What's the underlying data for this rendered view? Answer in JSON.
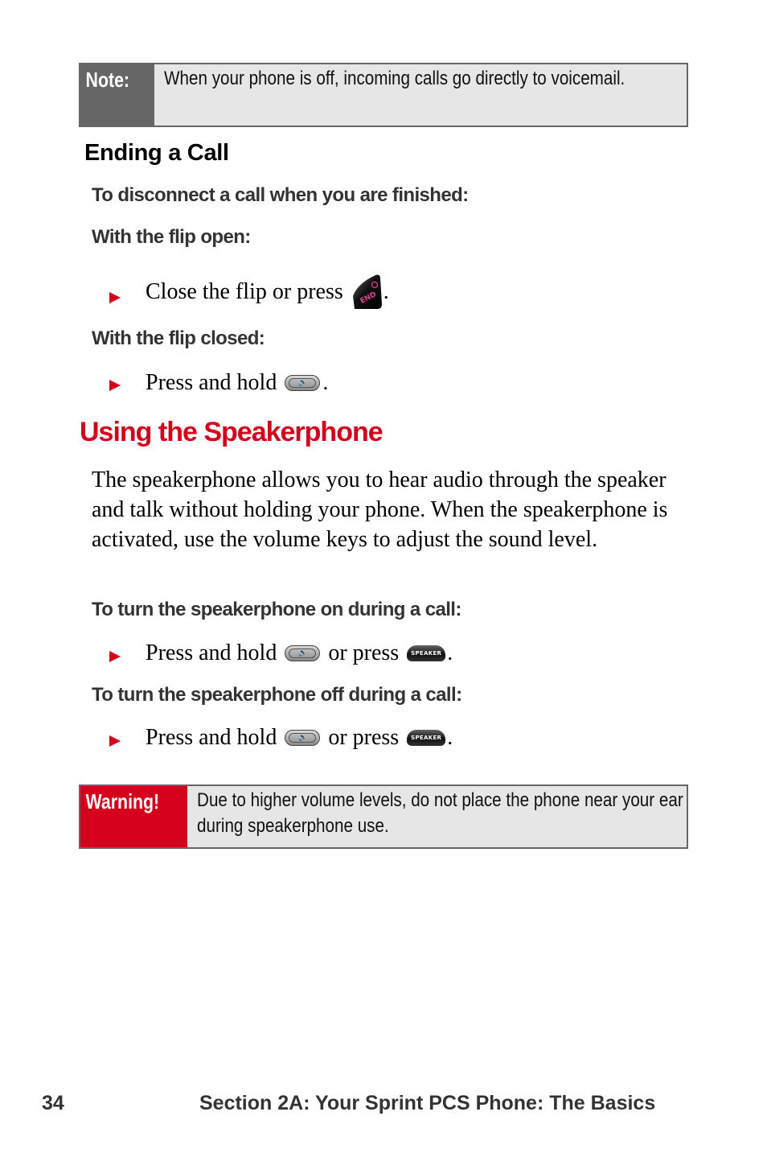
{
  "note": {
    "label": "Note:",
    "text": "When your phone is off, incoming calls go directly to voicemail."
  },
  "ending_call": {
    "heading": "Ending a Call",
    "intro": "To disconnect a call when you are finished:",
    "flip_open": {
      "subheading": "With the flip open:",
      "step_text": "Close the flip or press",
      "step_end": ".",
      "key_icon": "end-key-icon",
      "key_label": "END"
    },
    "flip_closed": {
      "subheading": "With the flip closed:",
      "step_text": "Press and hold",
      "step_end": ".",
      "key_icon": "side-speaker-key-icon"
    }
  },
  "speakerphone": {
    "heading": "Using the Speakerphone",
    "paragraph": "The speakerphone allows you to hear audio through the speaker and talk without holding your phone. When the speakerphone is activated, use the volume keys to adjust the sound level.",
    "turn_on": {
      "subheading": "To turn the speakerphone on during a call:",
      "step_text": "Press and hold",
      "step_mid": "or press",
      "step_end": ".",
      "key1_icon": "side-speaker-key-icon",
      "key2_label": "SPEAKER"
    },
    "turn_off": {
      "subheading": "To turn the speakerphone off during a call:",
      "step_text": "Press and hold",
      "step_mid": "or press",
      "step_end": ".",
      "key1_icon": "side-speaker-key-icon",
      "key2_label": "SPEAKER"
    }
  },
  "warning": {
    "label": "Warning!",
    "text": "Due to higher volume levels, do not place the phone near your ear during speakerphone use."
  },
  "footer": {
    "page_number": "34",
    "section_title": "Section 2A: Your Sprint PCS Phone: The Basics"
  },
  "colors": {
    "accent_red": "#d5001c",
    "note_gray": "#666666",
    "callout_bg": "#e6e6e6"
  }
}
